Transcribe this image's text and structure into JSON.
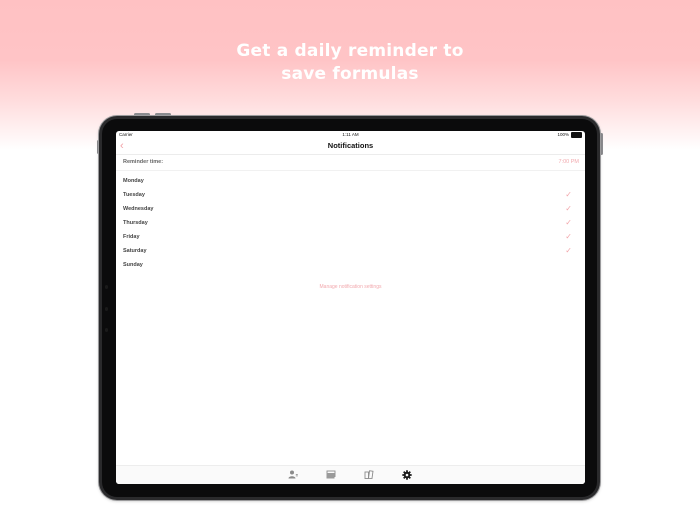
{
  "headline": {
    "line1": "Get a daily reminder to",
    "line2": "save formulas"
  },
  "status_bar": {
    "carrier": "Carrier",
    "time": "1:11 AM",
    "battery": "100%"
  },
  "nav": {
    "title": "Notifications",
    "back_icon": "chevron-left-icon"
  },
  "reminder": {
    "label": "Reminder time:",
    "time": "7:00 PM"
  },
  "days": [
    {
      "name": "Monday",
      "checked": false
    },
    {
      "name": "Tuesday",
      "checked": true
    },
    {
      "name": "Wednesday",
      "checked": true
    },
    {
      "name": "Thursday",
      "checked": true
    },
    {
      "name": "Friday",
      "checked": true
    },
    {
      "name": "Saturday",
      "checked": true
    },
    {
      "name": "Sunday",
      "checked": false
    }
  ],
  "manage_link": "Manage notification settings",
  "tabs": [
    {
      "icon": "person-icon"
    },
    {
      "icon": "cards-icon"
    },
    {
      "icon": "books-icon"
    },
    {
      "icon": "gear-icon",
      "active": true
    }
  ],
  "colors": {
    "accent": "#f2a6ab",
    "background_top": "#ffc1c3"
  }
}
